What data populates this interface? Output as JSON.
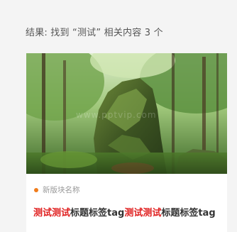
{
  "search": {
    "summary": "结果: 找到 “测试” 相关内容 3 个"
  },
  "result_card": {
    "image_alt": "forest rock image",
    "watermark": "www.pptvip.com",
    "block_name": "新版块名称",
    "dot_color": "#f07c1b",
    "highlight_color": "#e02020",
    "title_parts": [
      {
        "text": "测试测试",
        "highlight": true
      },
      {
        "text": "标题标签tag",
        "highlight": false
      },
      {
        "text": "测试测试",
        "highlight": true
      },
      {
        "text": "标题标签tag",
        "highlight": false
      }
    ]
  }
}
